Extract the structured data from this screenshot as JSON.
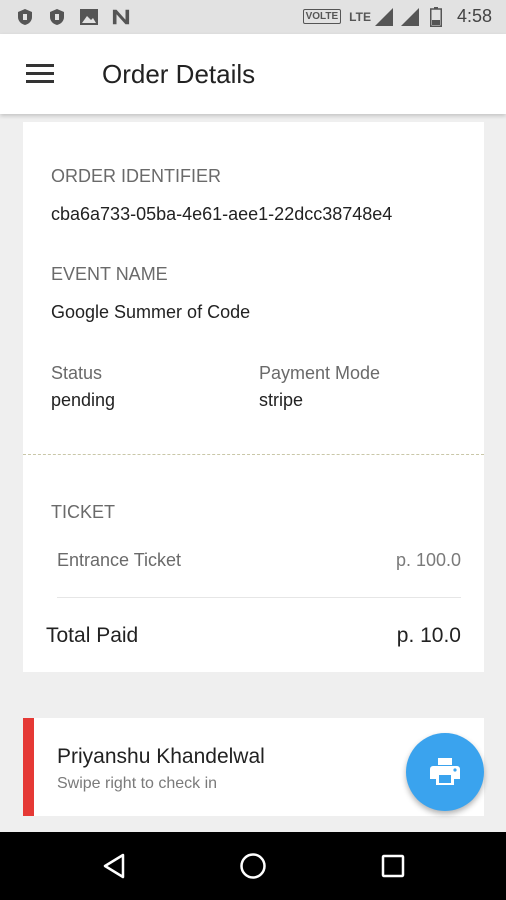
{
  "status_bar": {
    "volte": "VOLTE",
    "network": "LTE",
    "time": "4:58"
  },
  "app_bar": {
    "title": "Order Details",
    "menu_icon": "hamburger-menu-icon"
  },
  "order": {
    "identifier_label": "ORDER IDENTIFIER",
    "identifier_value": "cba6a733-05ba-4e61-aee1-22dcc38748e4",
    "event_label": "EVENT NAME",
    "event_value": "Google Summer of Code",
    "status_label": "Status",
    "status_value": "pending",
    "payment_label": "Payment Mode",
    "payment_value": "stripe"
  },
  "ticket": {
    "section_label": "TICKET",
    "name": "Entrance Ticket",
    "price": "p. 100.0",
    "total_label": "Total Paid",
    "total_value": "p. 10.0"
  },
  "attendee": {
    "name": "Priyanshu Khandelwal",
    "hint": "Swipe right to check in",
    "status_color": "#e53935"
  },
  "fab": {
    "icon": "print-icon",
    "color": "#3aa3ee"
  },
  "nav_bar": {
    "back_icon": "back-triangle-icon",
    "home_icon": "home-circle-icon",
    "recents_icon": "recents-square-icon"
  }
}
